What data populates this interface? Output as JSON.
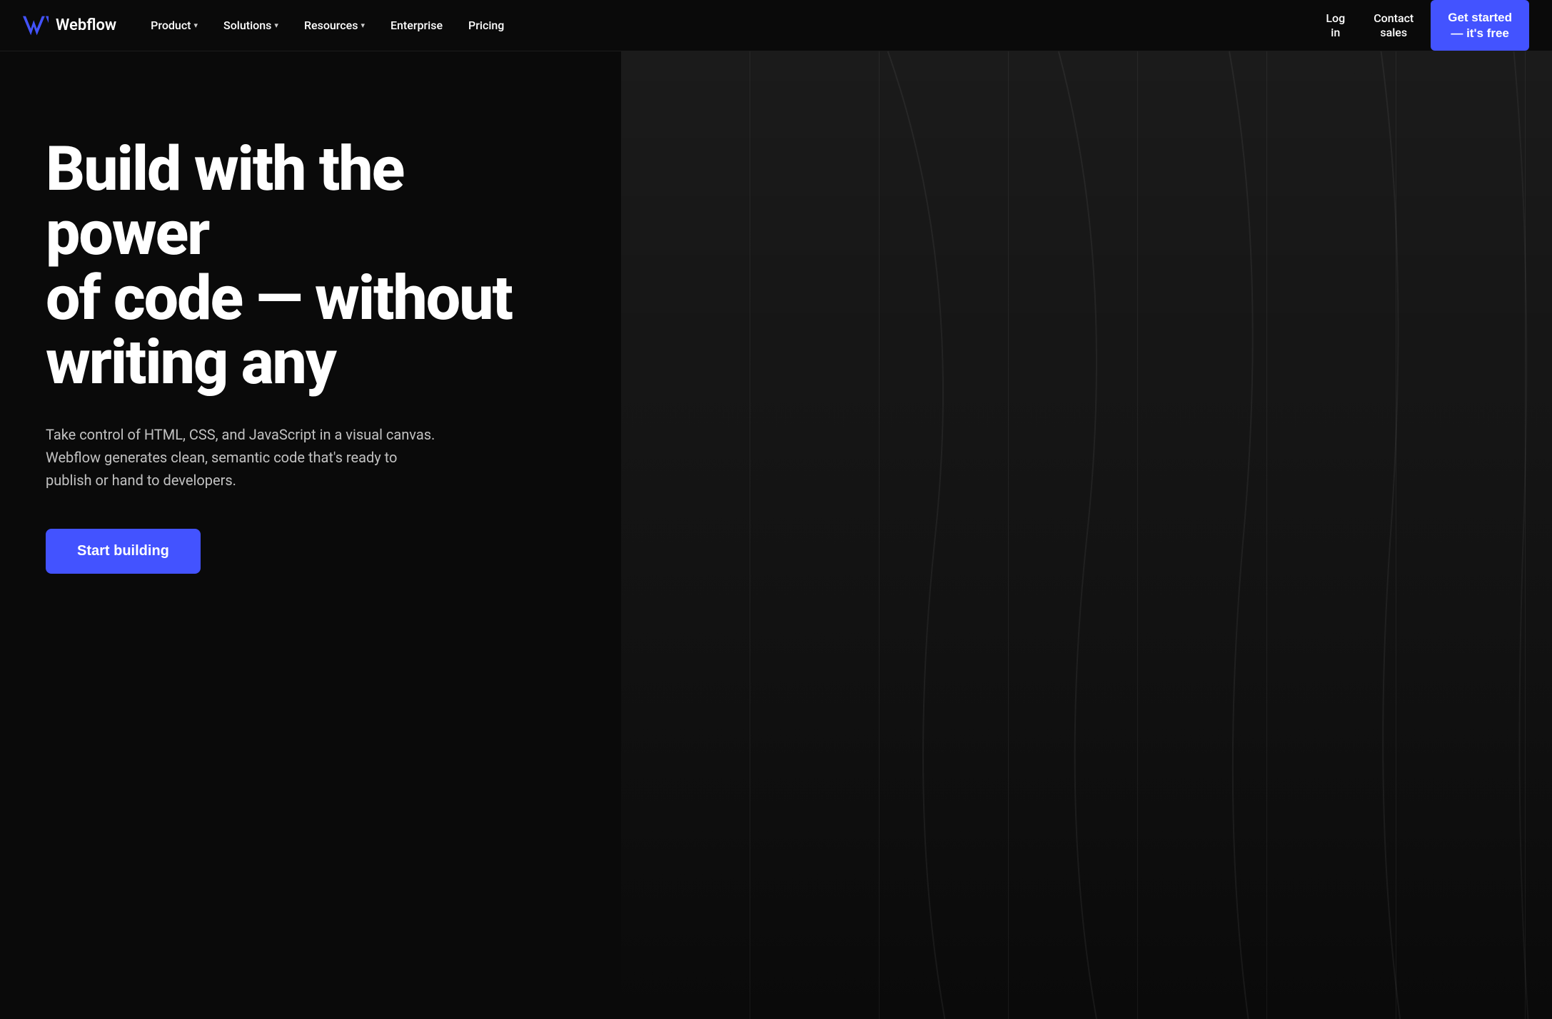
{
  "logo": {
    "name": "Webflow",
    "icon_alt": "webflow-logo"
  },
  "navbar": {
    "links": [
      {
        "label": "Product",
        "has_dropdown": true
      },
      {
        "label": "Solutions",
        "has_dropdown": true
      },
      {
        "label": "Resources",
        "has_dropdown": true
      },
      {
        "label": "Enterprise",
        "has_dropdown": false
      },
      {
        "label": "Pricing",
        "has_dropdown": false
      }
    ],
    "right_links": [
      {
        "label": "Log\nin"
      },
      {
        "label": "Contact\nsales"
      }
    ],
    "cta": {
      "line1": "Get started",
      "line2": "— it's free",
      "full_label": "Get started — it's free"
    }
  },
  "hero": {
    "headline_line1": "Build with the power",
    "headline_line2": "of code — without",
    "headline_line3": "writing any",
    "subtext": "Take control of HTML, CSS, and JavaScript in a visual canvas. Webflow generates clean, semantic code that's ready to publish or hand to developers.",
    "cta_button_label": "Start building"
  },
  "colors": {
    "background": "#0a0a0a",
    "accent": "#4353ff",
    "text_primary": "#ffffff",
    "text_muted": "rgba(255,255,255,0.75)"
  }
}
